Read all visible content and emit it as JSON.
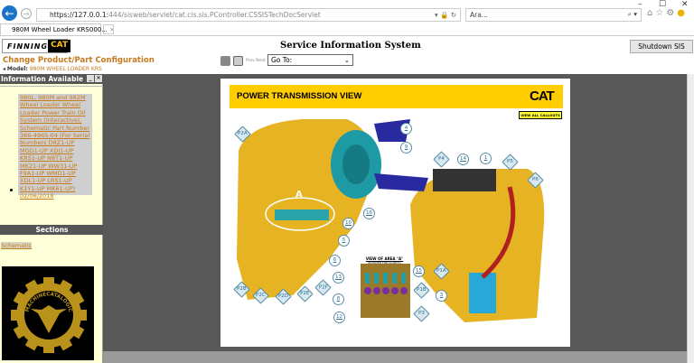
{
  "browser": {
    "url_main": "https://127.0.0.1:",
    "url_rest": "444/sisweb/servlet/cat.cis.sis.PController.CSSISTechDocServlet",
    "search_placeholder": "Ara...",
    "tab_title": "980M Wheel Loader KRS000...",
    "tab_close": "×",
    "minimize": "–",
    "maximize": "☐",
    "close": "✕"
  },
  "header": {
    "finning": "FINNING",
    "cat": "CAT",
    "title": "Service Information System",
    "change_config": "Change Product/Part Configuration",
    "model_label": "Model:",
    "model_value": "980M WHEEL LOADER KRS",
    "shutdown": "Shutdown SIS",
    "prev": "Prev",
    "next": "Next",
    "goto": "Go To:"
  },
  "left_panel": {
    "info_title": "Information Available",
    "info_link": "980L, 980M and 982M Wheel Loader Wheel Loader Power Train Oil System (Interactive), Schematic Part Number 366-4965-04 (For Serial Numbers D8Z1-UP MGD1-UP XDJ1-UP KRS1-UP N8T1-UP MK21-UP WW31-UP F9A1-UP WMD1-UP XDL1-UP LRS1-UP K1Y1-UP MK61-UP)",
    "info_date": "02/06/2018",
    "sections_title": "Sections",
    "section_item": "Schematic",
    "brand_logo_text": "MACHINECATALOGIC"
  },
  "document": {
    "title": "POWER TRANSMISSION VIEW",
    "cat_logo": "CAT",
    "view_all": "VIEW ALL CALLOUTS",
    "area_title": "VIEW OF AREA \"A\"",
    "area_sub": "(ROTATED FOR CLARITY)",
    "area_marker": "A",
    "callouts": [
      "P2A",
      "4",
      "9",
      "16",
      "10",
      "5",
      "6",
      "P2B",
      "P2C",
      "P2D",
      "P2E",
      "P2F",
      "13",
      "8",
      "12",
      "15",
      "P1B",
      "P3",
      "P1A",
      "3",
      "P4",
      "14",
      "1",
      "P5",
      "P6"
    ]
  },
  "colors": {
    "accent_orange": "#c67a1e",
    "cat_yellow": "#ffcd00",
    "panel_bg": "#ffffd8",
    "main_bg": "#585858"
  }
}
